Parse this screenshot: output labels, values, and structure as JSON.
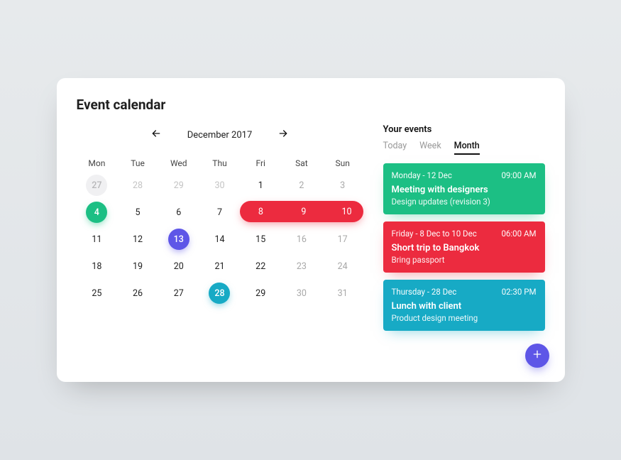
{
  "title": "Event calendar",
  "calendar": {
    "month_label": "December 2017",
    "weekdays": [
      "Mon",
      "Tue",
      "Wed",
      "Thu",
      "Fri",
      "Sat",
      "Sun"
    ],
    "days": [
      {
        "n": 27,
        "state": "outside-dot"
      },
      {
        "n": 28,
        "state": "outside"
      },
      {
        "n": 29,
        "state": "outside"
      },
      {
        "n": 30,
        "state": "outside"
      },
      {
        "n": 1
      },
      {
        "n": 2,
        "state": "weekend"
      },
      {
        "n": 3,
        "state": "weekend"
      },
      {
        "n": 4,
        "state": "dot",
        "color": "green"
      },
      {
        "n": 5
      },
      {
        "n": 6
      },
      {
        "n": 7
      },
      {
        "range": true,
        "start": 8,
        "mid": 9,
        "end": 10
      },
      {
        "n": 11
      },
      {
        "n": 12
      },
      {
        "n": 13,
        "state": "dot",
        "color": "purple"
      },
      {
        "n": 14
      },
      {
        "n": 15
      },
      {
        "n": 16,
        "state": "weekend"
      },
      {
        "n": 17,
        "state": "weekend"
      },
      {
        "n": 18
      },
      {
        "n": 19
      },
      {
        "n": 20
      },
      {
        "n": 21
      },
      {
        "n": 22
      },
      {
        "n": 23,
        "state": "weekend"
      },
      {
        "n": 24,
        "state": "weekend"
      },
      {
        "n": 25
      },
      {
        "n": 26
      },
      {
        "n": 27
      },
      {
        "n": 28,
        "state": "dot",
        "color": "teal"
      },
      {
        "n": 29
      },
      {
        "n": 30,
        "state": "weekend"
      },
      {
        "n": 31,
        "state": "weekend"
      }
    ]
  },
  "side": {
    "title": "Your events",
    "tabs": [
      "Today",
      "Week",
      "Month"
    ],
    "active_tab": "Month",
    "events": [
      {
        "color": "green",
        "date": "Monday - 12 Dec",
        "time": "09:00 AM",
        "title": "Meeting with designers",
        "sub": "Design updates (revision 3)"
      },
      {
        "color": "red",
        "date": "Friday - 8 Dec to 10 Dec",
        "time": "06:00 AM",
        "title": "Short trip to Bangkok",
        "sub": "Bring passport"
      },
      {
        "color": "teal",
        "date": "Thursday - 28 Dec",
        "time": "02:30 PM",
        "title": "Lunch with client",
        "sub": "Product design meeting"
      }
    ]
  }
}
